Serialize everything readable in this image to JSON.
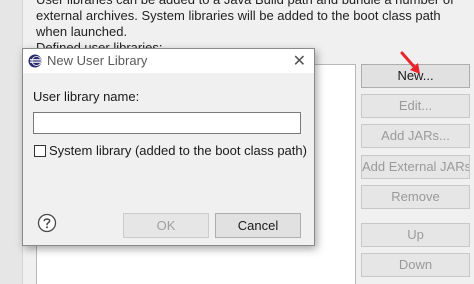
{
  "background": {
    "description": "User libraries can be added to a Java Build path and bundle a number of external archives. System libraries will be added to the boot class path when launched.",
    "defined_label": "Defined user libraries:",
    "buttons": {
      "new": "New...",
      "edit": "Edit...",
      "add_jars": "Add JARs...",
      "add_external_jars": "Add External JARs...",
      "remove": "Remove",
      "up": "Up",
      "down": "Down"
    }
  },
  "dialog": {
    "title": "New User Library",
    "close_glyph": "✕",
    "name_label": "User library name:",
    "name_value": "",
    "system_library_label": "System library (added to the boot class path)",
    "system_library_checked": false,
    "ok_label": "OK",
    "cancel_label": "Cancel"
  },
  "colors": {
    "arrow": "#e8232a",
    "help_icon": "#4a4a4a",
    "app_icon": "#2b2b6e"
  },
  "icons": {
    "app": "eclipse-icon",
    "help": "help-icon",
    "arrow": "pointer-arrow-icon"
  }
}
